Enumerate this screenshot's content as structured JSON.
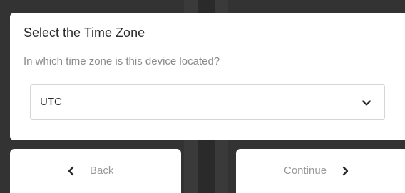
{
  "dialog": {
    "title": "Select the Time Zone",
    "subtitle": "In which time zone is this device located?",
    "timezone_select": {
      "value": "UTC",
      "icon": "chevron-down-icon"
    }
  },
  "navigation": {
    "back_label": "Back",
    "back_icon": "chevron-left-icon",
    "continue_label": "Continue",
    "continue_icon": "chevron-right-icon"
  },
  "colors": {
    "background": "#2a2a2a",
    "card": "#ffffff",
    "title_text": "#2b2b2b",
    "subtitle_text": "#8a8a8a",
    "button_text": "#9a9a9a"
  }
}
